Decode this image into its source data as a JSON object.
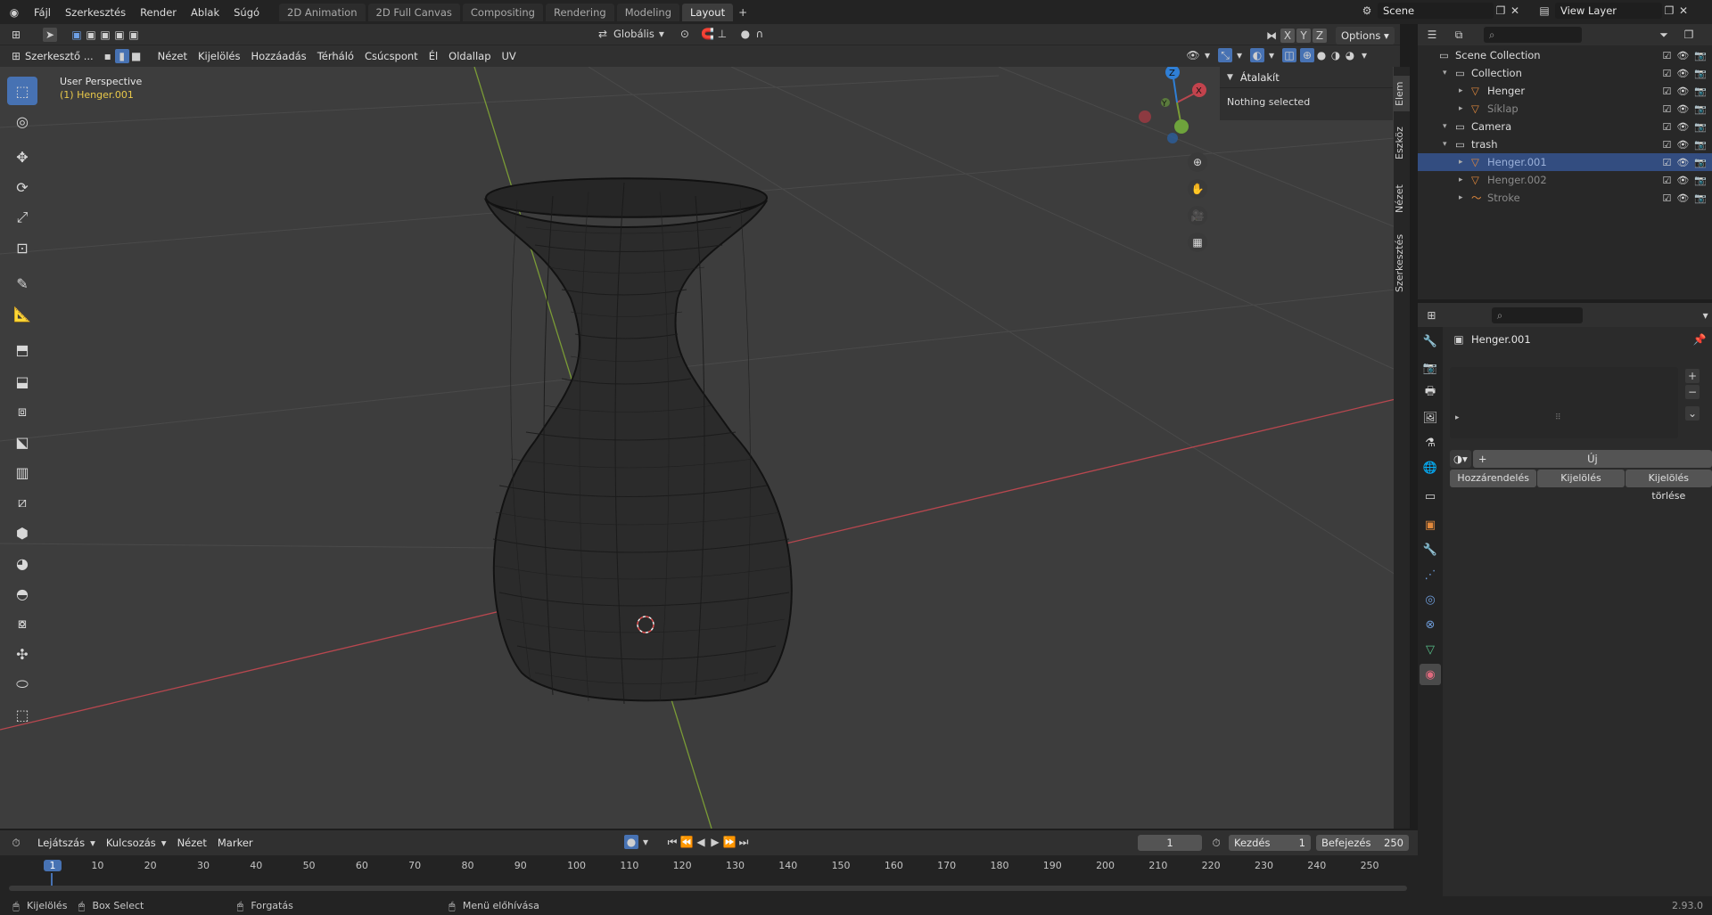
{
  "topbar": {
    "menus": [
      "Fájl",
      "Szerkesztés",
      "Render",
      "Ablak",
      "Súgó"
    ],
    "workspaces": [
      "2D Animation",
      "2D Full Canvas",
      "Compositing",
      "Rendering",
      "Modeling",
      "Layout"
    ],
    "active_workspace": "Layout",
    "scene": "Scene",
    "view_layer": "View Layer"
  },
  "vp_header": {
    "transform_orientation": "Globális",
    "axes": [
      "X",
      "Y",
      "Z"
    ],
    "options": "Options"
  },
  "vp_header2": {
    "mode": "Szerkesztő ...",
    "menus": [
      "Nézet",
      "Kijelölés",
      "Hozzáadás",
      "Térháló",
      "Csúcspont",
      "Él",
      "Oldallap",
      "UV"
    ]
  },
  "viewport": {
    "perspective": "User Perspective",
    "object": "(1) Henger.001",
    "gizmo_axes": {
      "x": "X",
      "y": "Y",
      "z": "Z"
    },
    "colors": {
      "x_axis": "#b8474f",
      "y_axis": "#7a9b36",
      "bg": "#3d3d3d"
    }
  },
  "n_panel": {
    "title": "Átalakít",
    "message": "Nothing selected",
    "tabs": [
      "Elem",
      "Eszköz",
      "Nézet",
      "Szerkesztés"
    ]
  },
  "outliner": {
    "rows": [
      {
        "name": "Scene Collection",
        "indent": 0,
        "icon": "collection-icon"
      },
      {
        "name": "Collection",
        "indent": 1,
        "icon": "collection-icon"
      },
      {
        "name": "Henger",
        "indent": 2,
        "icon": "mesh-icon"
      },
      {
        "name": "Síklap",
        "indent": 2,
        "icon": "mesh-icon",
        "dim": true
      },
      {
        "name": "Camera",
        "indent": 1,
        "icon": "collection-icon"
      },
      {
        "name": "trash",
        "indent": 1,
        "icon": "collection-icon"
      },
      {
        "name": "Henger.001",
        "indent": 2,
        "icon": "mesh-icon",
        "selected": true
      },
      {
        "name": "Henger.002",
        "indent": 2,
        "icon": "mesh-icon",
        "dim": true
      },
      {
        "name": "Stroke",
        "indent": 2,
        "icon": "stroke-icon",
        "dim": true
      }
    ]
  },
  "properties": {
    "object_name": "Henger.001",
    "new_button": "Új",
    "actions": [
      "Hozzárendelés",
      "Kijelölés",
      "Kijelölés törlése"
    ]
  },
  "timeline": {
    "menus": [
      "Lejátszás",
      "Kulcsozás",
      "Nézet",
      "Marker"
    ],
    "current_frame": "1",
    "start_label": "Kezdés",
    "start": "1",
    "end_label": "Befejezés",
    "end": "250",
    "ticks": [
      "1",
      "10",
      "20",
      "30",
      "40",
      "50",
      "60",
      "70",
      "80",
      "90",
      "100",
      "110",
      "120",
      "130",
      "140",
      "150",
      "160",
      "170",
      "180",
      "190",
      "200",
      "210",
      "220",
      "230",
      "240",
      "250"
    ]
  },
  "statusbar": {
    "select": "Kijelölés",
    "box_select": "Box Select",
    "rotate": "Forgatás",
    "menu": "Menü előhívása",
    "version": "2.93.0"
  }
}
